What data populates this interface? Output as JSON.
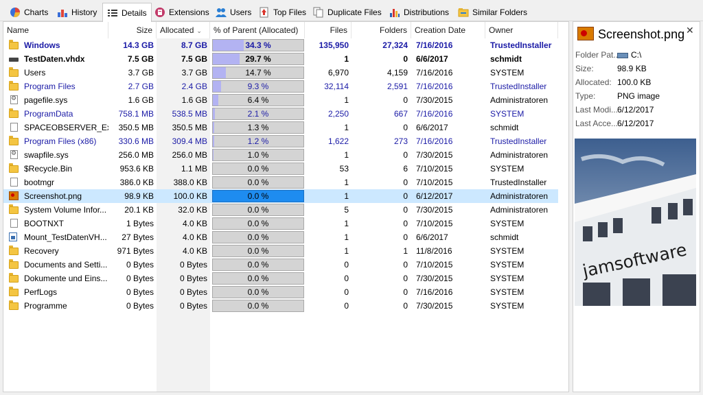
{
  "tabs": [
    {
      "label": "Charts",
      "icon": "pie-chart-icon"
    },
    {
      "label": "History",
      "icon": "bar-chart-icon"
    },
    {
      "label": "Details",
      "icon": "details-list-icon",
      "active": true
    },
    {
      "label": "Extensions",
      "icon": "extensions-icon"
    },
    {
      "label": "Users",
      "icon": "users-icon"
    },
    {
      "label": "Top Files",
      "icon": "top-files-icon"
    },
    {
      "label": "Duplicate Files",
      "icon": "duplicate-files-icon"
    },
    {
      "label": "Distributions",
      "icon": "distributions-icon"
    },
    {
      "label": "Similar Folders",
      "icon": "similar-folders-icon"
    }
  ],
  "columns": {
    "name": "Name",
    "size": "Size",
    "allocated": "Allocated",
    "percent": "% of Parent (Allocated)",
    "files": "Files",
    "folders": "Folders",
    "creation_date": "Creation Date",
    "owner": "Owner"
  },
  "rows": [
    {
      "name": "Windows",
      "size": "14.3 GB",
      "allocated": "8.7 GB",
      "percent": "34.3 %",
      "pct": 34.3,
      "files": "135,950",
      "folders": "27,324",
      "date": "7/16/2016",
      "owner": "TrustedInstaller",
      "icon": "folder-icon",
      "style": "bblue"
    },
    {
      "name": "TestDaten.vhdx",
      "size": "7.5 GB",
      "allocated": "7.5 GB",
      "percent": "29.7 %",
      "pct": 29.7,
      "files": "1",
      "folders": "0",
      "date": "6/6/2017",
      "owner": "schmidt",
      "icon": "drive-icon",
      "style": "bold"
    },
    {
      "name": "Users",
      "size": "3.7 GB",
      "allocated": "3.7 GB",
      "percent": "14.7 %",
      "pct": 14.7,
      "files": "6,970",
      "folders": "4,159",
      "date": "7/16/2016",
      "owner": "SYSTEM",
      "icon": "folder-icon",
      "style": ""
    },
    {
      "name": "Program Files",
      "size": "2.7 GB",
      "allocated": "2.4 GB",
      "percent": "9.3 %",
      "pct": 9.3,
      "files": "32,114",
      "folders": "2,591",
      "date": "7/16/2016",
      "owner": "TrustedInstaller",
      "icon": "folder-icon",
      "style": "blue"
    },
    {
      "name": "pagefile.sys",
      "size": "1.6 GB",
      "allocated": "1.6 GB",
      "percent": "6.4 %",
      "pct": 6.4,
      "files": "1",
      "folders": "0",
      "date": "7/30/2015",
      "owner": "Administratoren",
      "icon": "system-file-icon",
      "style": ""
    },
    {
      "name": "ProgramData",
      "size": "758.1 MB",
      "allocated": "538.5 MB",
      "percent": "2.1 %",
      "pct": 2.1,
      "files": "2,250",
      "folders": "667",
      "date": "7/16/2016",
      "owner": "SYSTEM",
      "icon": "folder-icon",
      "style": "blue"
    },
    {
      "name": "SPACEOBSERVER_Ex...",
      "size": "350.5 MB",
      "allocated": "350.5 MB",
      "percent": "1.3 %",
      "pct": 1.3,
      "files": "1",
      "folders": "0",
      "date": "6/6/2017",
      "owner": "schmidt",
      "icon": "file-icon",
      "style": ""
    },
    {
      "name": "Program Files (x86)",
      "size": "330.6 MB",
      "allocated": "309.4 MB",
      "percent": "1.2 %",
      "pct": 1.2,
      "files": "1,622",
      "folders": "273",
      "date": "7/16/2016",
      "owner": "TrustedInstaller",
      "icon": "folder-icon",
      "style": "blue"
    },
    {
      "name": "swapfile.sys",
      "size": "256.0 MB",
      "allocated": "256.0 MB",
      "percent": "1.0 %",
      "pct": 1.0,
      "files": "1",
      "folders": "0",
      "date": "7/30/2015",
      "owner": "Administratoren",
      "icon": "system-file-icon",
      "style": ""
    },
    {
      "name": "$Recycle.Bin",
      "size": "953.6 KB",
      "allocated": "1.1 MB",
      "percent": "0.0 %",
      "pct": 0,
      "files": "53",
      "folders": "6",
      "date": "7/10/2015",
      "owner": "SYSTEM",
      "icon": "folder-icon",
      "style": ""
    },
    {
      "name": "bootmgr",
      "size": "386.0 KB",
      "allocated": "388.0 KB",
      "percent": "0.0 %",
      "pct": 0,
      "files": "1",
      "folders": "0",
      "date": "7/10/2015",
      "owner": "TrustedInstaller",
      "icon": "file-icon",
      "style": ""
    },
    {
      "name": "Screenshot.png",
      "size": "98.9 KB",
      "allocated": "100.0 KB",
      "percent": "0.0 %",
      "pct": 0,
      "files": "1",
      "folders": "0",
      "date": "6/12/2017",
      "owner": "Administratoren",
      "icon": "png-file-icon",
      "style": "",
      "selected": true
    },
    {
      "name": "System Volume Infor...",
      "size": "20.1 KB",
      "allocated": "32.0 KB",
      "percent": "0.0 %",
      "pct": 0,
      "files": "5",
      "folders": "0",
      "date": "7/30/2015",
      "owner": "Administratoren",
      "icon": "folder-icon",
      "style": ""
    },
    {
      "name": "BOOTNXT",
      "size": "1 Bytes",
      "allocated": "4.0 KB",
      "percent": "0.0 %",
      "pct": 0,
      "files": "1",
      "folders": "0",
      "date": "7/10/2015",
      "owner": "SYSTEM",
      "icon": "file-icon",
      "style": ""
    },
    {
      "name": "Mount_TestDatenVH...",
      "size": "27 Bytes",
      "allocated": "4.0 KB",
      "percent": "0.0 %",
      "pct": 0,
      "files": "1",
      "folders": "0",
      "date": "6/6/2017",
      "owner": "schmidt",
      "icon": "mount-file-icon",
      "style": ""
    },
    {
      "name": "Recovery",
      "size": "971 Bytes",
      "allocated": "4.0 KB",
      "percent": "0.0 %",
      "pct": 0,
      "files": "1",
      "folders": "1",
      "date": "11/8/2016",
      "owner": "SYSTEM",
      "icon": "folder-icon",
      "style": ""
    },
    {
      "name": "Documents and Setti...",
      "size": "0 Bytes",
      "allocated": "0 Bytes",
      "percent": "0.0 %",
      "pct": 0,
      "files": "0",
      "folders": "0",
      "date": "7/10/2015",
      "owner": "SYSTEM",
      "icon": "folder-icon",
      "style": ""
    },
    {
      "name": "Dokumente und Eins...",
      "size": "0 Bytes",
      "allocated": "0 Bytes",
      "percent": "0.0 %",
      "pct": 0,
      "files": "0",
      "folders": "0",
      "date": "7/30/2015",
      "owner": "SYSTEM",
      "icon": "folder-icon",
      "style": ""
    },
    {
      "name": "PerfLogs",
      "size": "0 Bytes",
      "allocated": "0 Bytes",
      "percent": "0.0 %",
      "pct": 0,
      "files": "0",
      "folders": "0",
      "date": "7/16/2016",
      "owner": "SYSTEM",
      "icon": "folder-icon",
      "style": ""
    },
    {
      "name": "Programme",
      "size": "0 Bytes",
      "allocated": "0 Bytes",
      "percent": "0.0 %",
      "pct": 0,
      "files": "0",
      "folders": "0",
      "date": "7/30/2015",
      "owner": "SYSTEM",
      "icon": "folder-icon",
      "style": ""
    }
  ],
  "side": {
    "title": "Screenshot.png",
    "close": "✕",
    "props": [
      {
        "label": "Folder Pat...",
        "value": "C:\\"
      },
      {
        "label": "Size:",
        "value": "98.9 KB"
      },
      {
        "label": "Allocated:",
        "value": "100.0 KB"
      },
      {
        "label": "Type:",
        "value": "PNG image"
      },
      {
        "label": "Last Modi...",
        "value": "6/12/2017"
      },
      {
        "label": "Last Acce...",
        "value": "6/12/2017"
      }
    ],
    "preview_text": "jamsoftware"
  },
  "colors": {
    "selection": "#cce8ff",
    "bar_fill": "#b3b3f2",
    "bar_selected": "#1e8cf0",
    "link_blue": "#1a1aa6"
  }
}
